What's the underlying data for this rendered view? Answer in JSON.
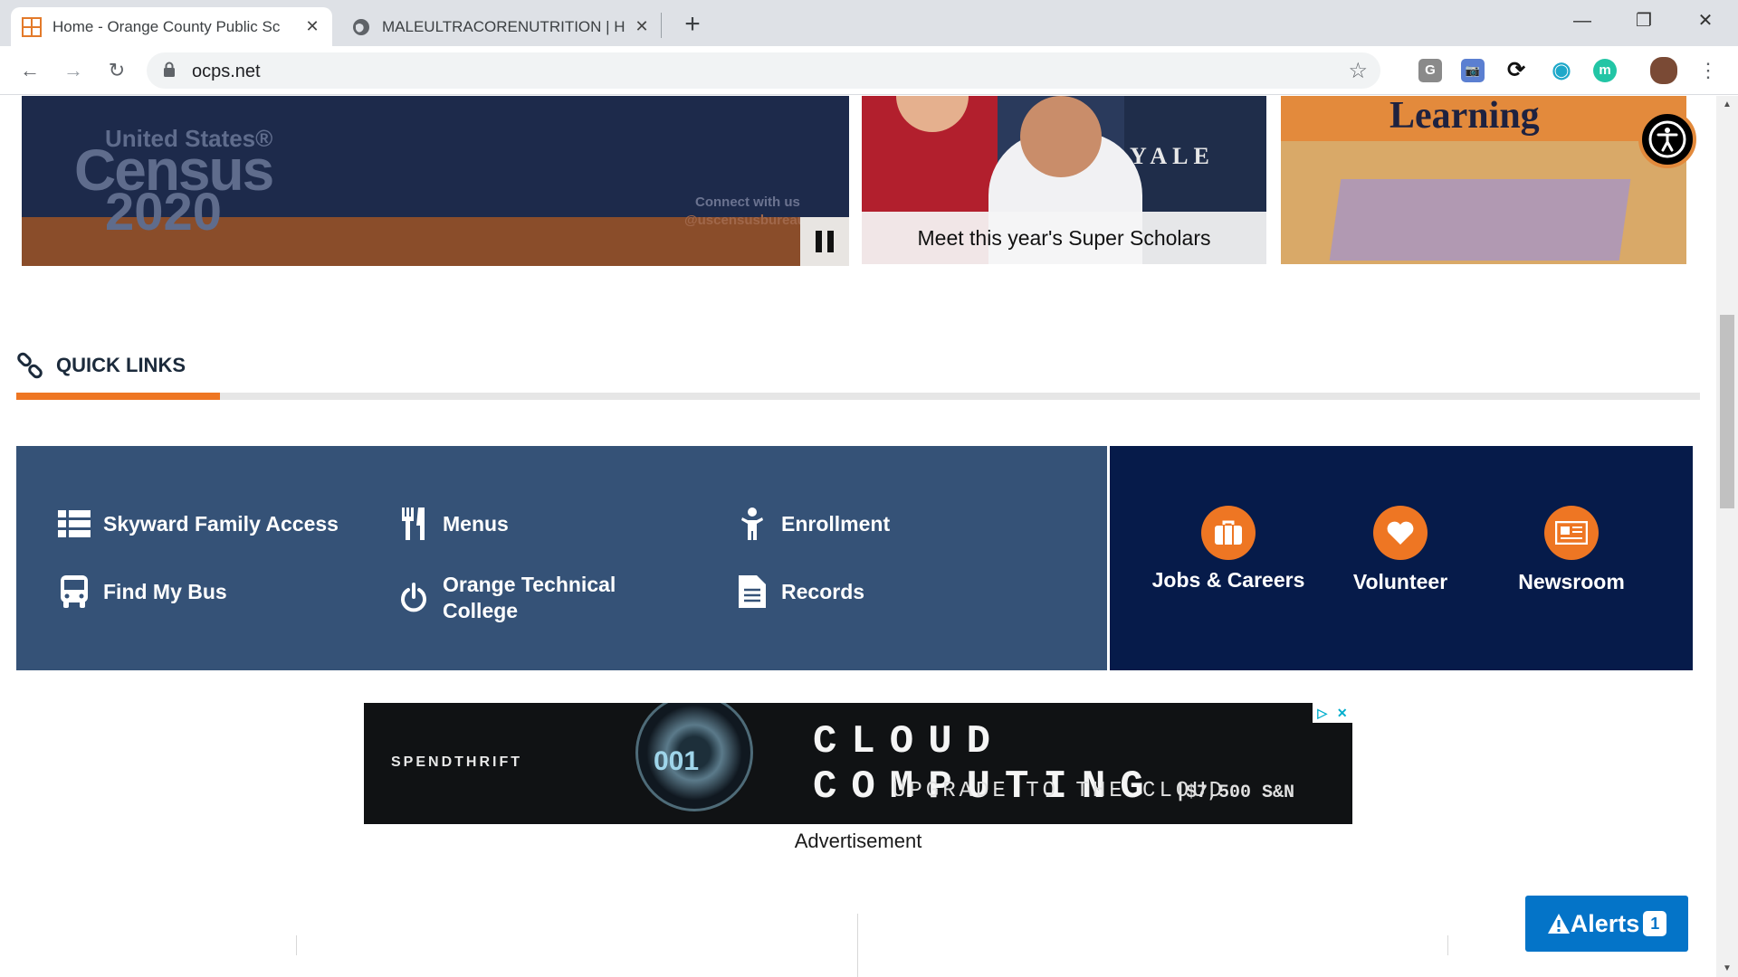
{
  "browser": {
    "tabs": [
      {
        "title": "Home - Orange County Public Sc",
        "favicon": "ocps-favicon",
        "active": true
      },
      {
        "title": "MALEULTRACORENUTRITION | H",
        "favicon": "globe-icon",
        "active": false
      }
    ],
    "new_tab_symbol": "+",
    "window_controls": {
      "minimize": "—",
      "restore": "❐",
      "close": "✕"
    },
    "toolbar": {
      "back": "←",
      "forward": "→",
      "reload": "↻",
      "url": "ocps.net",
      "star": "☆",
      "extensions": [
        {
          "name": "g-extension-icon",
          "label": "G",
          "color": "#8a8a8a"
        },
        {
          "name": "camera-extension-icon",
          "label": "📷",
          "color": "#5b7fd1"
        },
        {
          "name": "sync-extension-icon",
          "label": "⟳",
          "color": "#111111"
        },
        {
          "name": "globe-extension-icon",
          "label": "◉",
          "color": "#1ea8c9"
        },
        {
          "name": "m-extension-icon",
          "label": "m",
          "color": "#22c5a5"
        }
      ],
      "menu": "⋮"
    }
  },
  "hero": {
    "census": {
      "line1": "United States®",
      "line2": "Census",
      "line3": "2020",
      "connect": "Connect with us",
      "handle": "@uscensusbureau"
    },
    "scholars": {
      "yale": "YALE",
      "caption": "Meet this year's Super Scholars"
    },
    "learning": {
      "word": "Learning"
    }
  },
  "quick_links": {
    "title": "QUICK LINKS",
    "accent_color": "#ee7623",
    "left": [
      {
        "label": "Skyward Family Access",
        "icon": "list-icon"
      },
      {
        "label": "Menus",
        "icon": "utensils-icon"
      },
      {
        "label": "Enrollment",
        "icon": "child-icon"
      },
      {
        "label": "Find My Bus",
        "icon": "bus-icon"
      },
      {
        "label": "Orange Technical College",
        "icon": "power-icon"
      },
      {
        "label": "Records",
        "icon": "document-icon"
      }
    ],
    "right": [
      {
        "label": "Jobs & Careers",
        "icon": "briefcase-icon"
      },
      {
        "label": "Volunteer",
        "icon": "heart-icon"
      },
      {
        "label": "Newsroom",
        "icon": "newspaper-icon"
      }
    ]
  },
  "ad": {
    "brand": "SPENDTHRIFT",
    "lens_text": "001",
    "headline": "CLOUD COMPUTING",
    "sub": "UPGRADE TO THE CLOUD.",
    "price": "|$7,500 S&N",
    "label": "Advertisement"
  },
  "alerts": {
    "label": "Alerts",
    "count": "1"
  }
}
